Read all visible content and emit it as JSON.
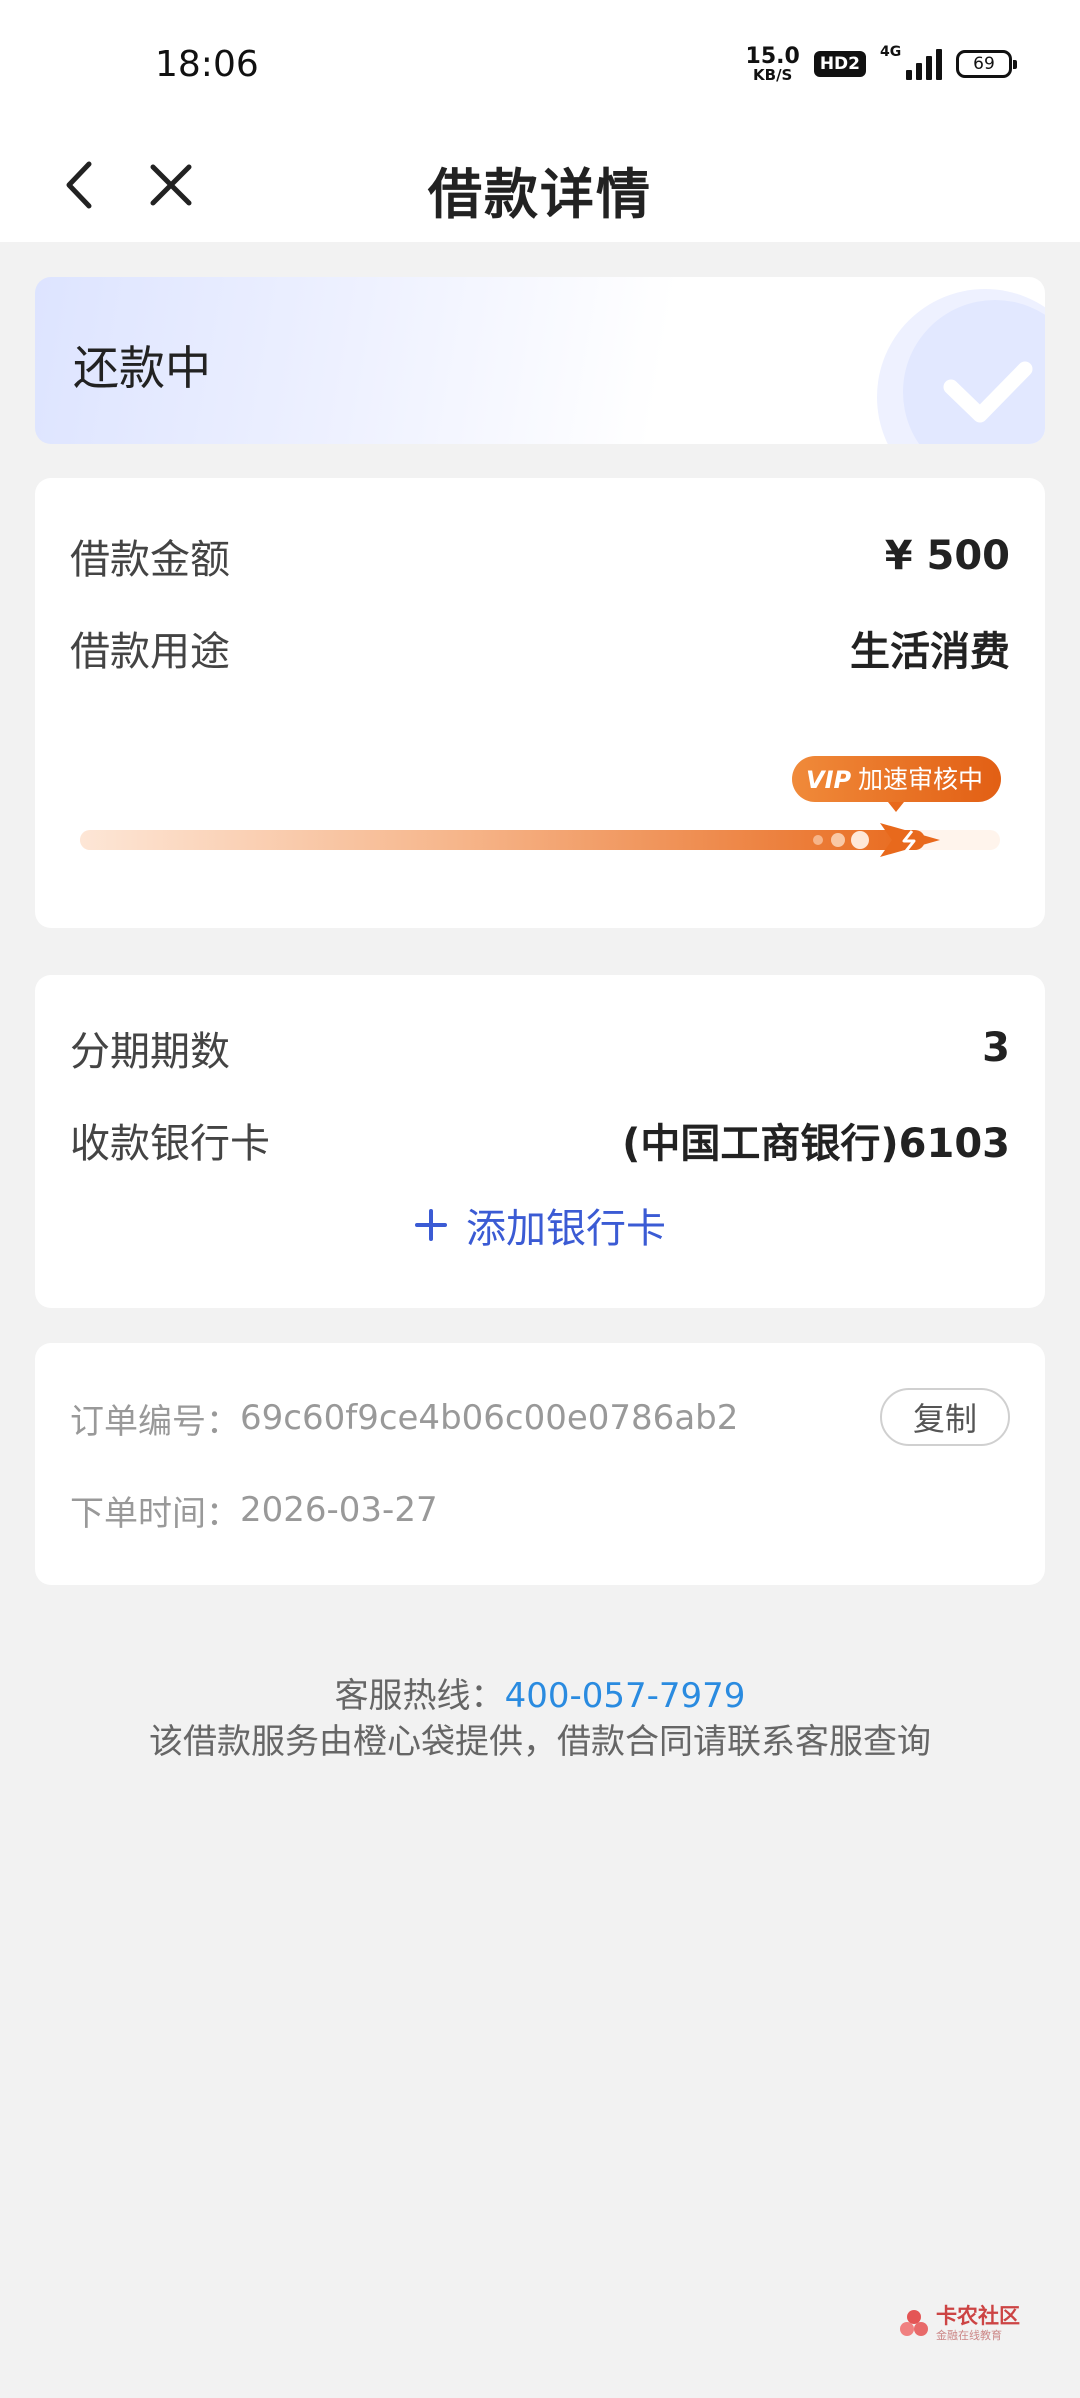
{
  "status_bar": {
    "time": "18:06",
    "net_speed": "15.0",
    "net_speed_unit": "KB/S",
    "hd": "HD2",
    "network": "4G",
    "battery": "69"
  },
  "nav": {
    "title": "借款详情"
  },
  "status": {
    "text": "还款中"
  },
  "loan": {
    "amount_label": "借款金额",
    "amount_value": "¥ 500",
    "purpose_label": "借款用途",
    "purpose_value": "生活消费",
    "vip_badge_text": "加速审核中",
    "vip_badge_brand": "VIP"
  },
  "installment": {
    "periods_label": "分期期数",
    "periods_value": "3",
    "bank_label": "收款银行卡",
    "bank_value": "(中国工商银行)6103",
    "add_card_label": "添加银行卡"
  },
  "order": {
    "number_label": "订单编号：",
    "number_value": "69c60f9ce4b06c00e0786ab2",
    "copy_label": "复制",
    "time_label": "下单时间：",
    "time_value": "2026-03-27"
  },
  "footer": {
    "hotline_label": "客服热线：",
    "hotline_number": "400-057-7979",
    "note": "该借款服务由橙心袋提供，借款合同请联系客服查询"
  },
  "watermark": {
    "title": "卡农社区",
    "subtitle": "金融在线教育"
  },
  "colors": {
    "accent_blue": "#3b5bd4",
    "hotline_blue": "#2a8be0",
    "progress_orange": "#e8691c"
  }
}
